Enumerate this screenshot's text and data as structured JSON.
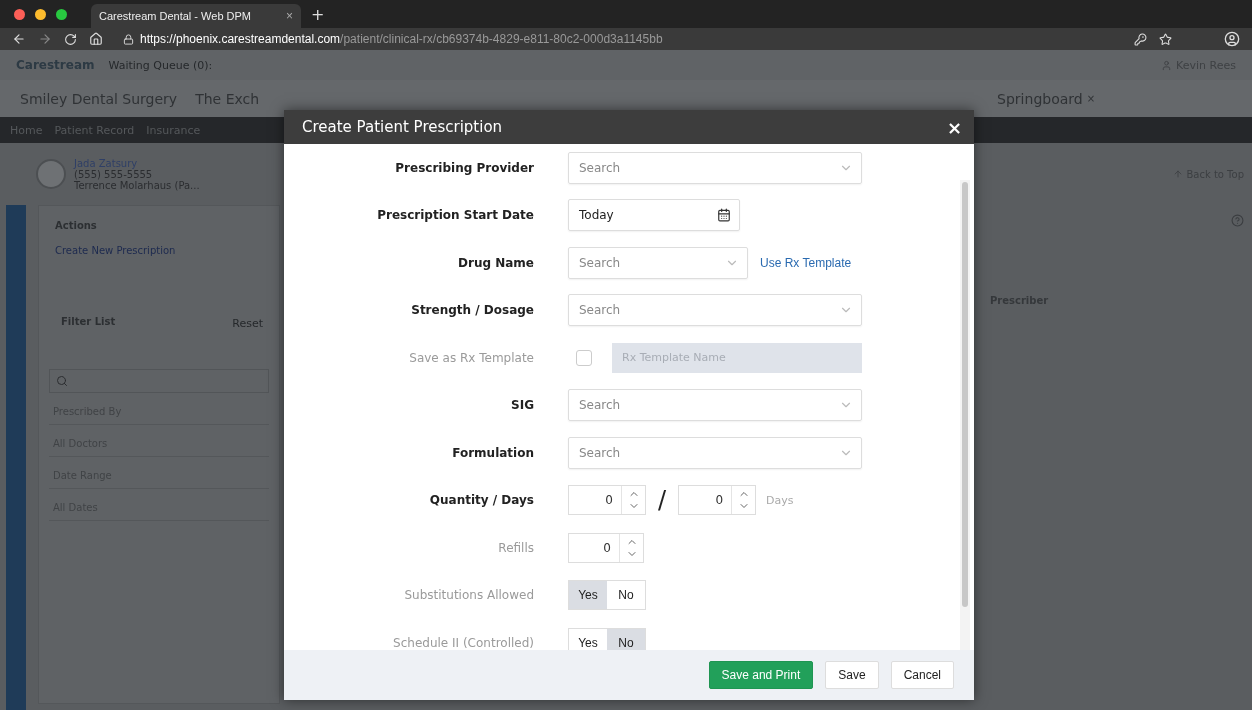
{
  "browser": {
    "tab_title": "Carestream Dental - Web DPM",
    "tab_close": "×",
    "new_tab": "+",
    "url_host": "https://phoenix.carestreamdental.com",
    "url_path": "/patient/clinical-rx/cb69374b-4829-e811-80c2-000d3a1145bb"
  },
  "app": {
    "logo": "Carestream",
    "waiting_queue": "Waiting Queue (0):",
    "user": "Kevin Rees"
  },
  "location_tabs": [
    {
      "label": "Smiley Dental Surgery"
    },
    {
      "label": "The Exch"
    },
    {
      "label": "Springboard",
      "close": "×"
    }
  ],
  "nav": [
    "Home",
    "Patient Record",
    "Insurance"
  ],
  "patient": {
    "name": "Jada Zatsury",
    "phone": "(555) 555-5555",
    "provider": "Terrence Molarhaus (Pa..."
  },
  "back_to_top": "Back to Top",
  "actions": {
    "title": "Actions",
    "items": [
      "Create New Prescription"
    ]
  },
  "filter": {
    "title": "Filter List",
    "reset": "Reset",
    "groups": [
      {
        "title": "Prescribed By",
        "value": "All Doctors"
      },
      {
        "title": "Date Range",
        "value": "All Dates"
      }
    ]
  },
  "table": {
    "columns": [
      "Prescriber"
    ]
  },
  "modal": {
    "title": "Create Patient Prescription",
    "close": "×",
    "fields": [
      {
        "kind": "select",
        "label": "Prescribing Provider",
        "required": true,
        "placeholder": "Search"
      },
      {
        "kind": "date",
        "label": "Prescription Start Date",
        "required": true,
        "value": "Today"
      },
      {
        "kind": "select_link",
        "label": "Drug Name",
        "required": true,
        "placeholder": "Search",
        "link": "Use Rx Template"
      },
      {
        "kind": "select",
        "label": "Strength / Dosage",
        "required": true,
        "placeholder": "Search"
      },
      {
        "kind": "checkbox_text",
        "label": "Save as Rx Template",
        "required": false,
        "checked": false,
        "placeholder": "Rx Template Name"
      },
      {
        "kind": "select",
        "label": "SIG",
        "required": true,
        "placeholder": "Search"
      },
      {
        "kind": "select",
        "label": "Formulation",
        "required": true,
        "placeholder": "Search"
      },
      {
        "kind": "quantity",
        "label": "Quantity / Days",
        "required": true,
        "quantity": "0",
        "separator": "/",
        "days": "0",
        "unit": "Days"
      },
      {
        "kind": "spinner",
        "label": "Refills",
        "required": false,
        "value": "0"
      },
      {
        "kind": "toggle",
        "label": "Substitutions Allowed",
        "required": false,
        "options": [
          {
            "label": "Yes",
            "selected": true
          },
          {
            "label": "No",
            "selected": false
          }
        ]
      },
      {
        "kind": "toggle",
        "label": "Schedule II (Controlled)",
        "required": false,
        "options": [
          {
            "label": "Yes",
            "selected": false
          },
          {
            "label": "No",
            "selected": true
          }
        ]
      }
    ],
    "buttons": [
      {
        "label": "Save and Print",
        "primary": true
      },
      {
        "label": "Save",
        "primary": false
      },
      {
        "label": "Cancel",
        "primary": false
      }
    ]
  }
}
